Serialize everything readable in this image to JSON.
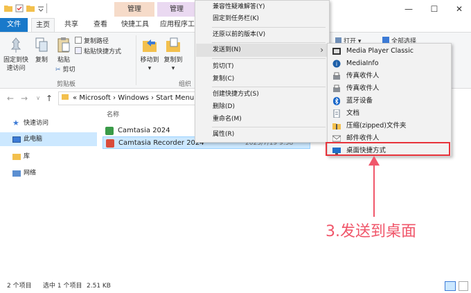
{
  "titlebar": {
    "context_tabs": [
      {
        "label": "管理",
        "color": "#f6dbc9"
      },
      {
        "label": "管理",
        "color": "#ead9f1"
      }
    ],
    "controls": {
      "minimize": "—",
      "maximize": "☐",
      "close": "✕"
    }
  },
  "ribbon_tabs": {
    "file": "文件",
    "home": "主页",
    "share": "共享",
    "view": "查看",
    "drive_tools": "快捷工具",
    "app_tools": "应用程序工"
  },
  "ribbon": {
    "pin_quick_access": [
      "固定到快",
      "速访问"
    ],
    "copy": "复制",
    "paste": "粘贴",
    "copy_path": "复制路径",
    "paste_shortcut": "粘贴快捷方式",
    "cut": "剪切",
    "clipboard_group": "剪贴板",
    "move_to": "移动到",
    "copy_to": "复制到",
    "organize_group": "组织",
    "open": "打开",
    "select_all": "全部选择"
  },
  "address": {
    "path_prefix": "«",
    "crumbs": [
      "Microsoft",
      "Windows",
      "Start Menu"
    ]
  },
  "nav_pane": {
    "items": [
      {
        "label": "快速访问",
        "icon": "star-icon"
      },
      {
        "label": "此电脑",
        "icon": "computer-icon"
      },
      {
        "label": "库",
        "icon": "library-icon"
      },
      {
        "label": "网络",
        "icon": "network-icon"
      }
    ]
  },
  "file_list": {
    "column_name": "名称",
    "files": [
      {
        "name": "Camtasia 2024",
        "selected": false
      },
      {
        "name": "Camtasia Recorder 2024",
        "selected": true,
        "date": "2023/7/19 9:58"
      }
    ]
  },
  "status": {
    "count": "2 个项目",
    "selection": "选中 1 个项目",
    "size": "2.51 KB"
  },
  "context_menu": {
    "items": [
      "兼容性疑难解答(Y)",
      "固定到任务栏(K)",
      "还原以前的版本(V)",
      "发送到(N)",
      "剪切(T)",
      "复制(C)",
      "创建快捷方式(S)",
      "删除(D)",
      "重命名(M)",
      "属性(R)"
    ],
    "submenu_arrow": "›"
  },
  "send_to_menu": {
    "items": [
      {
        "label": "Media Player Classic",
        "icon": "media-player-icon"
      },
      {
        "label": "MediaInfo",
        "icon": "mediainfo-icon"
      },
      {
        "label": "传真收件人",
        "icon": "fax-icon"
      },
      {
        "label": "传真收件人",
        "icon": "fax-icon"
      },
      {
        "label": "蓝牙设备",
        "icon": "bluetooth-icon"
      },
      {
        "label": "文档",
        "icon": "documents-icon"
      },
      {
        "label": "压缩(zipped)文件夹",
        "icon": "zip-folder-icon"
      },
      {
        "label": "邮件收件人",
        "icon": "mail-icon"
      },
      {
        "label": "桌面快捷方式",
        "icon": "desktop-icon"
      }
    ]
  },
  "annotation": {
    "text": "3.发送到桌面",
    "color": "#f0566a"
  },
  "colors": {
    "accent": "#1979ca",
    "selection": "#cce8ff",
    "highlight_box": "#e8333b"
  }
}
